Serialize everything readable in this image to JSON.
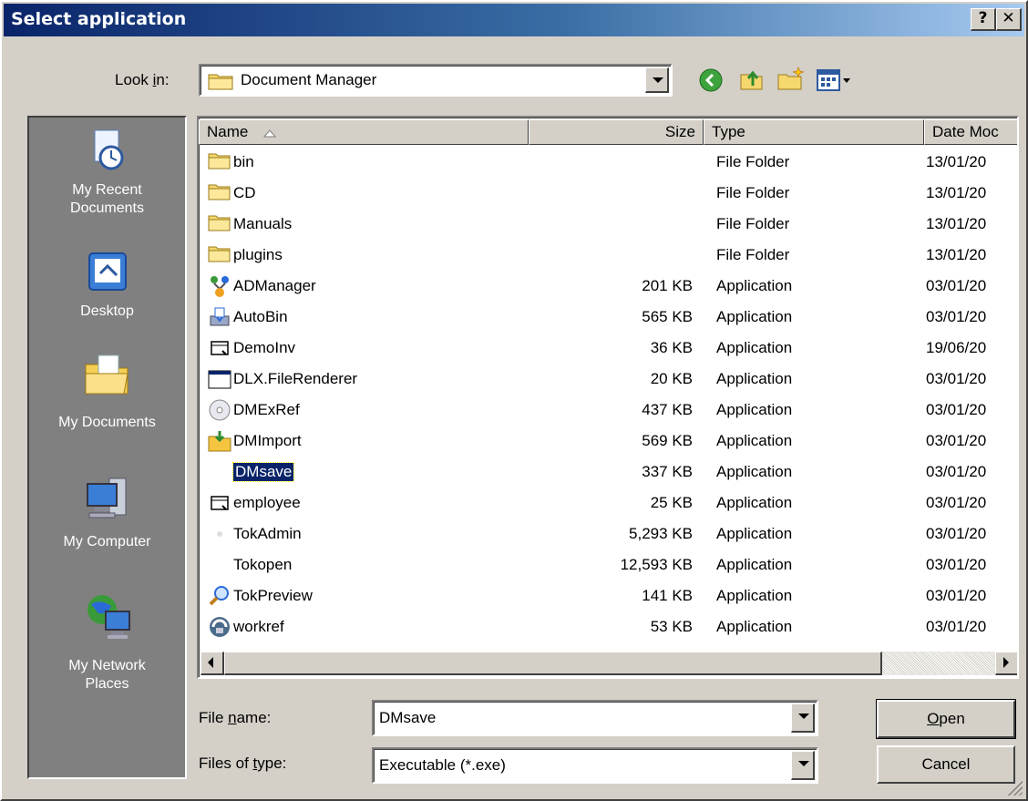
{
  "window": {
    "title": "Select application",
    "help_button": "?",
    "close_button": "✕"
  },
  "look_in": {
    "label_pre": "Look ",
    "label_u": "i",
    "label_post": "n:",
    "value": "Document Manager"
  },
  "toolbar": {
    "icons": [
      "back-icon",
      "up-folder-icon",
      "new-folder-icon",
      "view-menu-icon"
    ]
  },
  "places": [
    {
      "line1": "My Recent",
      "line2": "Documents",
      "icon": "recent-documents-icon"
    },
    {
      "line1": "Desktop",
      "line2": "",
      "icon": "desktop-icon"
    },
    {
      "line1": "My Documents",
      "line2": "",
      "icon": "my-documents-icon"
    },
    {
      "line1": "My Computer",
      "line2": "",
      "icon": "my-computer-icon"
    },
    {
      "line1": "My Network",
      "line2": "Places",
      "icon": "network-places-icon"
    }
  ],
  "columns": {
    "name": "Name",
    "size": "Size",
    "type": "Type",
    "date": "Date Moc"
  },
  "files": [
    {
      "name": "bin",
      "size": "",
      "type": "File Folder",
      "date": "13/01/20",
      "icon": "folder-icon"
    },
    {
      "name": "CD",
      "size": "",
      "type": "File Folder",
      "date": "13/01/20",
      "icon": "folder-icon"
    },
    {
      "name": "Manuals",
      "size": "",
      "type": "File Folder",
      "date": "13/01/20",
      "icon": "folder-icon"
    },
    {
      "name": "plugins",
      "size": "",
      "type": "File Folder",
      "date": "13/01/20",
      "icon": "folder-icon"
    },
    {
      "name": "ADManager",
      "size": "201 KB",
      "type": "Application",
      "date": "03/01/20",
      "icon": "admanager-icon"
    },
    {
      "name": "AutoBin",
      "size": "565 KB",
      "type": "Application",
      "date": "03/01/20",
      "icon": "autobin-icon"
    },
    {
      "name": "DemoInv",
      "size": "36 KB",
      "type": "Application",
      "date": "19/06/20",
      "icon": "app-window-icon"
    },
    {
      "name": "DLX.FileRenderer",
      "size": "20 KB",
      "type": "Application",
      "date": "03/01/20",
      "icon": "generic-exe-icon"
    },
    {
      "name": "DMExRef",
      "size": "437 KB",
      "type": "Application",
      "date": "03/01/20",
      "icon": "disc-icon"
    },
    {
      "name": "DMImport",
      "size": "569 KB",
      "type": "Application",
      "date": "03/01/20",
      "icon": "import-folder-icon"
    },
    {
      "name": "DMsave",
      "size": "337 KB",
      "type": "Application",
      "date": "03/01/20",
      "icon": "dmsave-icon",
      "selected": true
    },
    {
      "name": "employee",
      "size": "25 KB",
      "type": "Application",
      "date": "03/01/20",
      "icon": "app-window-icon"
    },
    {
      "name": "TokAdmin",
      "size": "5,293 KB",
      "type": "Application",
      "date": "03/01/20",
      "icon": "tokadmin-icon"
    },
    {
      "name": "Tokopen",
      "size": "12,593 KB",
      "type": "Application",
      "date": "03/01/20",
      "icon": "tokopen-icon"
    },
    {
      "name": "TokPreview",
      "size": "141 KB",
      "type": "Application",
      "date": "03/01/20",
      "icon": "magnifier-icon"
    },
    {
      "name": "workref",
      "size": "53 KB",
      "type": "Application",
      "date": "03/01/20",
      "icon": "workref-icon"
    }
  ],
  "file_name": {
    "label_pre": "File ",
    "label_u": "n",
    "label_post": "ame:",
    "value": "DMsave"
  },
  "file_type": {
    "label_pre": "Files of ",
    "label_u": "t",
    "label_post": "ype:",
    "value": "Executable (*.exe)"
  },
  "buttons": {
    "open_u": "O",
    "open_rest": "pen",
    "cancel": "Cancel"
  }
}
